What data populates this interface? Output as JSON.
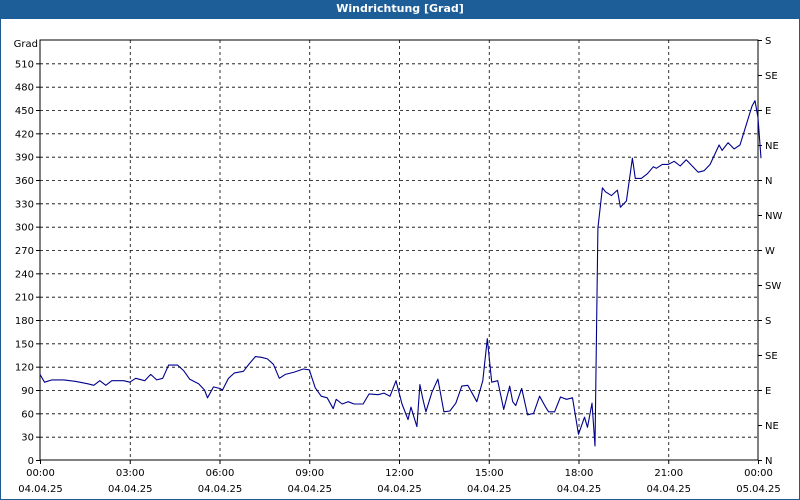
{
  "window": {
    "title": "Windrichtung [Grad]"
  },
  "chart_data": {
    "type": "line",
    "title": "Windrichtung [Grad]",
    "ylabel": "Grad",
    "ylim": [
      0,
      540
    ],
    "yticks": [
      0,
      30,
      60,
      90,
      120,
      150,
      180,
      210,
      240,
      270,
      300,
      330,
      360,
      390,
      420,
      450,
      480,
      510
    ],
    "y2_labels": [
      "N",
      "NE",
      "E",
      "SE",
      "S",
      "SW",
      "W",
      "NW",
      "N",
      "NE",
      "E",
      "SE",
      "S"
    ],
    "xlim": [
      0,
      24
    ],
    "x_unit": "hours after 04.04.25 00:00",
    "xticks": [
      {
        "time": "00:00",
        "date": "04.04.25"
      },
      {
        "time": "03:00",
        "date": "04.04.25"
      },
      {
        "time": "06:00",
        "date": "04.04.25"
      },
      {
        "time": "09:00",
        "date": "04.04.25"
      },
      {
        "time": "12:00",
        "date": "04.04.25"
      },
      {
        "time": "15:00",
        "date": "04.04.25"
      },
      {
        "time": "18:00",
        "date": "04.04.25"
      },
      {
        "time": "21:00",
        "date": "04.04.25"
      },
      {
        "time": "00:00",
        "date": "05.04.25"
      }
    ],
    "grid": true,
    "series": [
      {
        "color": "#00008b",
        "points": [
          [
            0.0,
            110
          ],
          [
            0.15,
            100
          ],
          [
            0.4,
            103
          ],
          [
            0.8,
            103
          ],
          [
            1.2,
            101
          ],
          [
            1.6,
            98
          ],
          [
            1.8,
            96
          ],
          [
            2.0,
            102
          ],
          [
            2.2,
            96
          ],
          [
            2.4,
            102
          ],
          [
            2.8,
            102
          ],
          [
            3.0,
            100
          ],
          [
            3.2,
            105
          ],
          [
            3.5,
            102
          ],
          [
            3.7,
            110
          ],
          [
            3.9,
            103
          ],
          [
            4.1,
            105
          ],
          [
            4.3,
            122
          ],
          [
            4.6,
            122
          ],
          [
            4.8,
            115
          ],
          [
            5.0,
            104
          ],
          [
            5.3,
            98
          ],
          [
            5.5,
            90
          ],
          [
            5.6,
            80
          ],
          [
            5.8,
            94
          ],
          [
            6.0,
            92
          ],
          [
            6.1,
            90
          ],
          [
            6.3,
            105
          ],
          [
            6.5,
            112
          ],
          [
            6.8,
            114
          ],
          [
            7.0,
            124
          ],
          [
            7.2,
            133
          ],
          [
            7.4,
            132
          ],
          [
            7.6,
            130
          ],
          [
            7.8,
            123
          ],
          [
            8.0,
            105
          ],
          [
            8.2,
            110
          ],
          [
            8.5,
            113
          ],
          [
            8.8,
            117
          ],
          [
            9.0,
            116
          ],
          [
            9.2,
            93
          ],
          [
            9.4,
            82
          ],
          [
            9.6,
            80
          ],
          [
            9.8,
            66
          ],
          [
            9.9,
            78
          ],
          [
            10.1,
            72
          ],
          [
            10.3,
            75
          ],
          [
            10.5,
            72
          ],
          [
            10.8,
            72
          ],
          [
            11.0,
            85
          ],
          [
            11.3,
            84
          ],
          [
            11.5,
            86
          ],
          [
            11.7,
            82
          ],
          [
            11.9,
            102
          ],
          [
            12.1,
            72
          ],
          [
            12.3,
            52
          ],
          [
            12.4,
            68
          ],
          [
            12.5,
            55
          ],
          [
            12.6,
            43
          ],
          [
            12.7,
            97
          ],
          [
            12.8,
            78
          ],
          [
            12.9,
            62
          ],
          [
            13.1,
            87
          ],
          [
            13.3,
            104
          ],
          [
            13.5,
            62
          ],
          [
            13.7,
            63
          ],
          [
            13.9,
            73
          ],
          [
            14.1,
            95
          ],
          [
            14.3,
            96
          ],
          [
            14.5,
            82
          ],
          [
            14.6,
            75
          ],
          [
            14.8,
            102
          ],
          [
            14.95,
            156
          ],
          [
            15.1,
            100
          ],
          [
            15.3,
            102
          ],
          [
            15.5,
            65
          ],
          [
            15.7,
            95
          ],
          [
            15.8,
            75
          ],
          [
            15.9,
            70
          ],
          [
            16.1,
            92
          ],
          [
            16.3,
            58
          ],
          [
            16.5,
            60
          ],
          [
            16.7,
            82
          ],
          [
            16.9,
            68
          ],
          [
            17.0,
            62
          ],
          [
            17.2,
            62
          ],
          [
            17.4,
            81
          ],
          [
            17.6,
            78
          ],
          [
            17.8,
            80
          ],
          [
            18.0,
            33
          ],
          [
            18.2,
            55
          ],
          [
            18.3,
            42
          ],
          [
            18.45,
            73
          ],
          [
            18.55,
            18
          ],
          [
            18.65,
            298
          ],
          [
            18.8,
            350
          ],
          [
            18.9,
            345
          ],
          [
            19.1,
            340
          ],
          [
            19.3,
            347
          ],
          [
            19.4,
            325
          ],
          [
            19.6,
            333
          ],
          [
            19.8,
            388
          ],
          [
            19.9,
            362
          ],
          [
            20.1,
            362
          ],
          [
            20.3,
            368
          ],
          [
            20.5,
            377
          ],
          [
            20.6,
            375
          ],
          [
            20.8,
            380
          ],
          [
            21.0,
            380
          ],
          [
            21.2,
            384
          ],
          [
            21.4,
            378
          ],
          [
            21.6,
            386
          ],
          [
            21.8,
            378
          ],
          [
            22.0,
            370
          ],
          [
            22.2,
            372
          ],
          [
            22.4,
            380
          ],
          [
            22.7,
            405
          ],
          [
            22.8,
            398
          ],
          [
            23.0,
            408
          ],
          [
            23.2,
            400
          ],
          [
            23.4,
            405
          ],
          [
            23.6,
            430
          ],
          [
            23.8,
            455
          ],
          [
            23.9,
            462
          ],
          [
            24.0,
            440
          ],
          [
            24.1,
            388
          ]
        ]
      }
    ]
  }
}
